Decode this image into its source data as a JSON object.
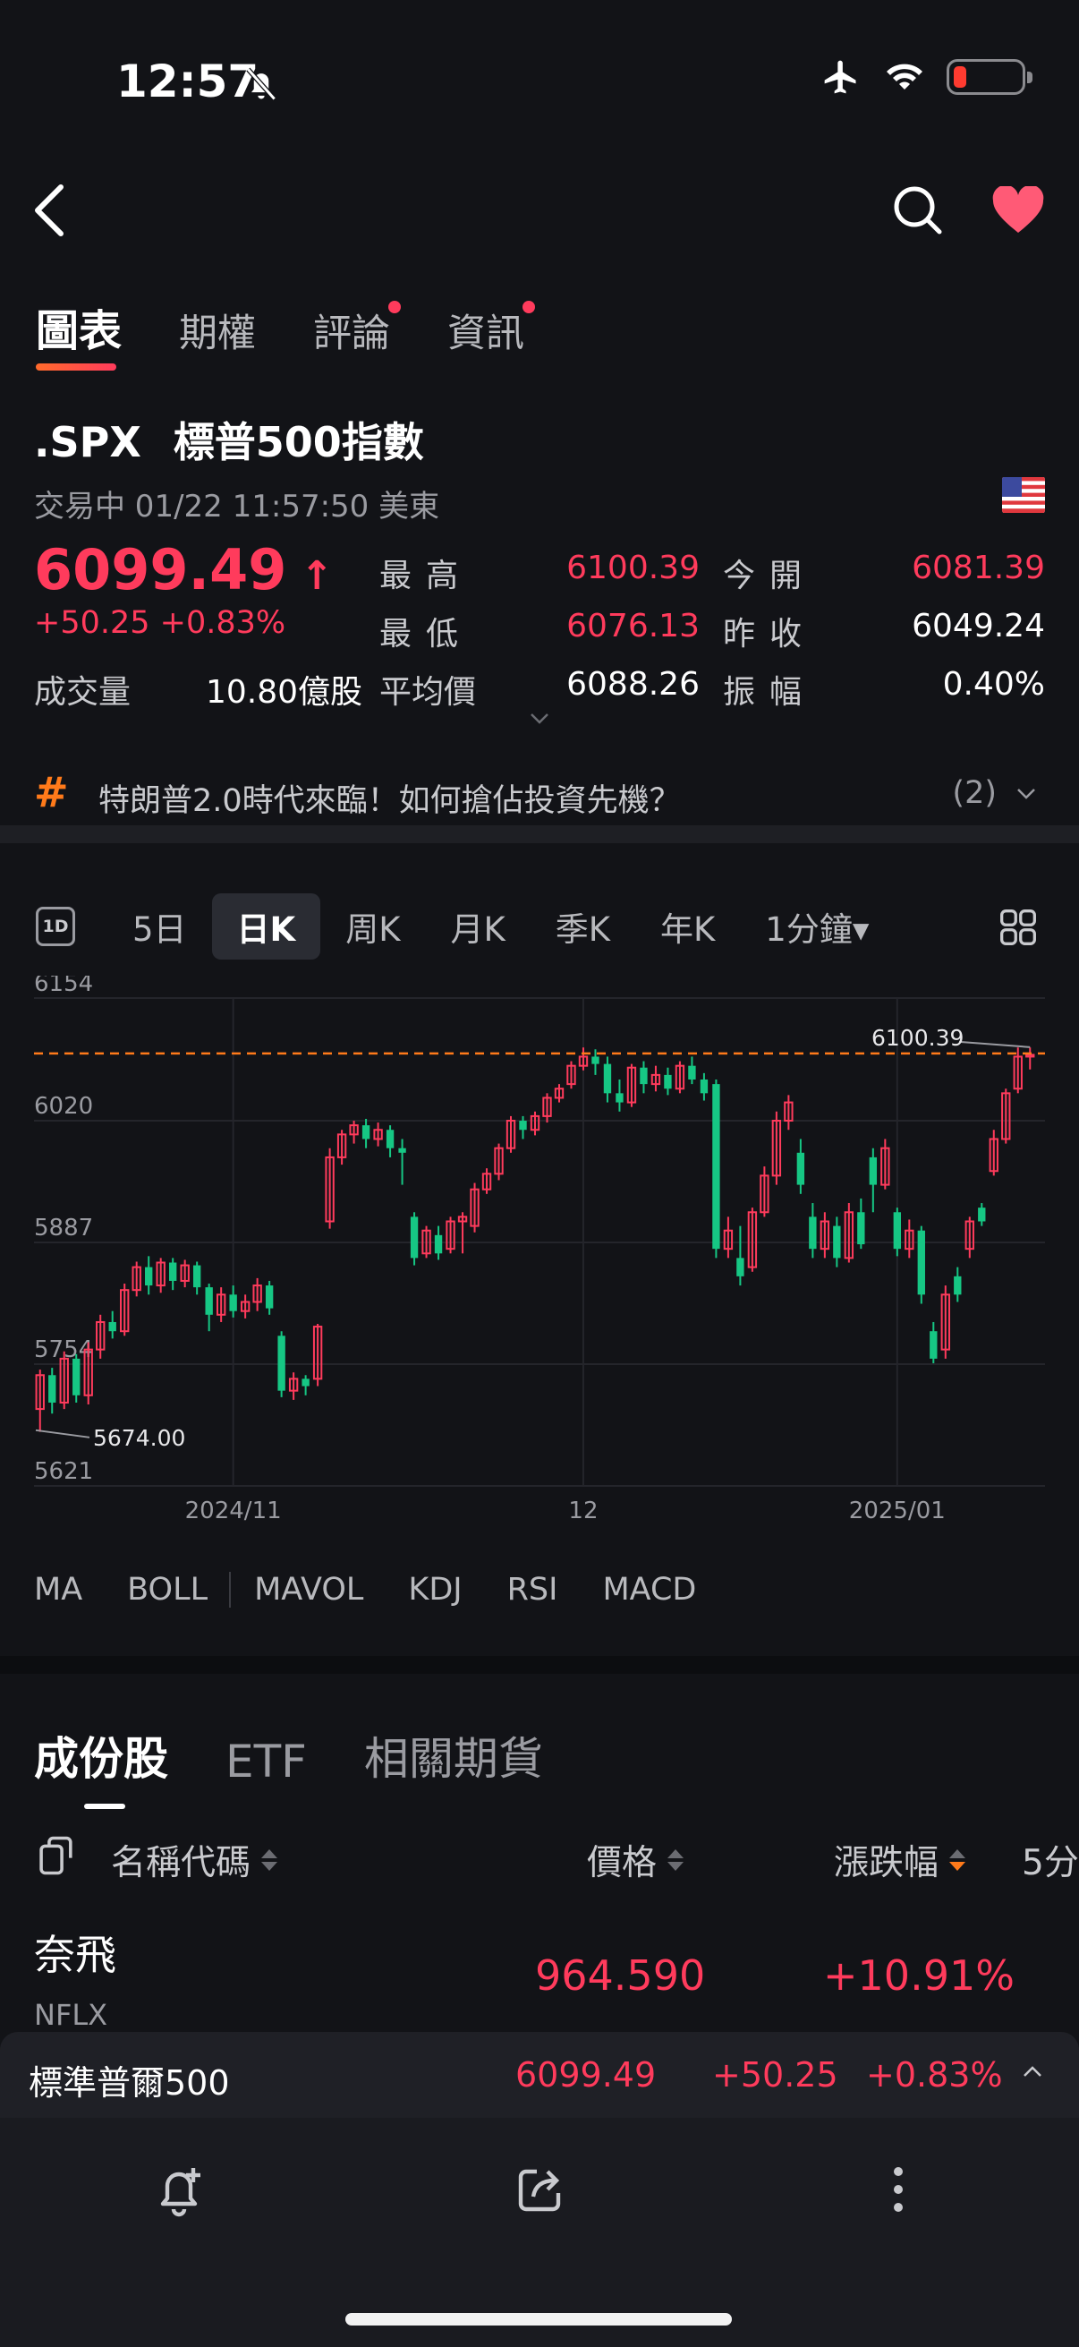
{
  "status_bar": {
    "time": "12:57"
  },
  "tabs": [
    {
      "label": "圖表",
      "active": true,
      "dot": false
    },
    {
      "label": "期權",
      "active": false,
      "dot": false
    },
    {
      "label": "評論",
      "active": false,
      "dot": true
    },
    {
      "label": "資訊",
      "active": false,
      "dot": true
    }
  ],
  "quote": {
    "symbol": ".SPX",
    "name": "標普500指數",
    "trading_status": "交易中 01/22 11:57:50 美東",
    "price": "6099.49",
    "change": "+50.25",
    "change_pct": "+0.83%",
    "volume_label": "成交量",
    "volume": "10.80億股",
    "stats": {
      "high_label": "最高",
      "high": "6100.39",
      "open_label": "今開",
      "open": "6081.39",
      "low_label": "最低",
      "low": "6076.13",
      "prev_close_label": "昨收",
      "prev_close": "6049.24",
      "avg_label": "平均價",
      "avg": "6088.26",
      "amp_label": "振幅",
      "amp": "0.40%"
    }
  },
  "topic": {
    "text": "特朗普2.0時代來臨！如何搶佔投資先機？",
    "count": "(2)"
  },
  "periods": {
    "icon_label": "1D",
    "items": [
      "5日",
      "日K",
      "周K",
      "月K",
      "季K",
      "年K",
      "1分鐘▾"
    ],
    "active": "日K"
  },
  "chart_data": {
    "type": "candlestick",
    "y_ticks": [
      "6154",
      "6020",
      "5887",
      "5754",
      "5621"
    ],
    "x_ticks": [
      "2024/11",
      "12",
      "2025/01"
    ],
    "high_marker": "6100.39",
    "low_marker": "5674.00",
    "ylim": [
      5621,
      6154
    ],
    "colors": {
      "up": "#ff3b5c",
      "down": "#16c784",
      "ref_line": "#ff7a1a"
    },
    "candles": [
      [
        5705,
        5742,
        5680,
        5748
      ],
      [
        5742,
        5712,
        5700,
        5750
      ],
      [
        5712,
        5760,
        5705,
        5768
      ],
      [
        5760,
        5720,
        5712,
        5765
      ],
      [
        5720,
        5770,
        5710,
        5778
      ],
      [
        5770,
        5800,
        5760,
        5808
      ],
      [
        5800,
        5790,
        5782,
        5812
      ],
      [
        5790,
        5835,
        5785,
        5842
      ],
      [
        5835,
        5860,
        5828,
        5866
      ],
      [
        5860,
        5840,
        5830,
        5872
      ],
      [
        5840,
        5865,
        5832,
        5870
      ],
      [
        5865,
        5845,
        5835,
        5870
      ],
      [
        5845,
        5862,
        5838,
        5868
      ],
      [
        5862,
        5838,
        5830,
        5866
      ],
      [
        5838,
        5808,
        5790,
        5842
      ],
      [
        5808,
        5830,
        5800,
        5838
      ],
      [
        5830,
        5812,
        5805,
        5840
      ],
      [
        5812,
        5822,
        5804,
        5830
      ],
      [
        5822,
        5840,
        5812,
        5848
      ],
      [
        5840,
        5815,
        5808,
        5845
      ],
      [
        5785,
        5725,
        5718,
        5790
      ],
      [
        5725,
        5738,
        5715,
        5745
      ],
      [
        5738,
        5730,
        5720,
        5742
      ],
      [
        5738,
        5795,
        5730,
        5798
      ],
      [
        5910,
        5980,
        5902,
        5990
      ],
      [
        5980,
        6005,
        5972,
        6010
      ],
      [
        6005,
        6015,
        5995,
        6020
      ],
      [
        6015,
        6000,
        5990,
        6022
      ],
      [
        6000,
        6010,
        5992,
        6018
      ],
      [
        6010,
        5990,
        5980,
        6015
      ],
      [
        5990,
        5985,
        5950,
        6000
      ],
      [
        5915,
        5870,
        5862,
        5920
      ],
      [
        5875,
        5900,
        5870,
        5905
      ],
      [
        5895,
        5875,
        5868,
        5905
      ],
      [
        5880,
        5910,
        5875,
        5915
      ],
      [
        5910,
        5915,
        5875,
        5920
      ],
      [
        5905,
        5945,
        5898,
        5952
      ],
      [
        5945,
        5962,
        5940,
        5968
      ],
      [
        5962,
        5990,
        5955,
        5995
      ],
      [
        5990,
        6020,
        5985,
        6025
      ],
      [
        6020,
        6010,
        6000,
        6025
      ],
      [
        6010,
        6025,
        6004,
        6030
      ],
      [
        6025,
        6045,
        6018,
        6050
      ],
      [
        6045,
        6055,
        6040,
        6060
      ],
      [
        6060,
        6080,
        6055,
        6085
      ],
      [
        6080,
        6090,
        6075,
        6100
      ],
      [
        6090,
        6082,
        6070,
        6098
      ],
      [
        6082,
        6050,
        6040,
        6090
      ],
      [
        6050,
        6040,
        6030,
        6065
      ],
      [
        6040,
        6078,
        6035,
        6082
      ],
      [
        6078,
        6060,
        6050,
        6085
      ],
      [
        6060,
        6070,
        6052,
        6080
      ],
      [
        6070,
        6055,
        6048,
        6078
      ],
      [
        6055,
        6080,
        6050,
        6085
      ],
      [
        6080,
        6065,
        6060,
        6090
      ],
      [
        6065,
        6050,
        6042,
        6072
      ],
      [
        6060,
        5880,
        5870,
        6065
      ],
      [
        5880,
        5900,
        5870,
        5915
      ],
      [
        5870,
        5850,
        5840,
        5905
      ],
      [
        5860,
        5920,
        5855,
        5925
      ],
      [
        5920,
        5960,
        5915,
        5970
      ],
      [
        5960,
        6020,
        5950,
        6030
      ],
      [
        6020,
        6040,
        6010,
        6048
      ],
      [
        5985,
        5950,
        5940,
        6000
      ],
      [
        5915,
        5880,
        5870,
        5930
      ],
      [
        5880,
        5910,
        5870,
        5920
      ],
      [
        5905,
        5870,
        5860,
        5915
      ],
      [
        5870,
        5920,
        5865,
        5930
      ],
      [
        5920,
        5885,
        5880,
        5935
      ],
      [
        5980,
        5950,
        5920,
        5990
      ],
      [
        5950,
        5990,
        5945,
        6000
      ],
      [
        5920,
        5880,
        5872,
        5925
      ],
      [
        5880,
        5900,
        5870,
        5912
      ],
      [
        5900,
        5830,
        5820,
        5905
      ],
      [
        5790,
        5760,
        5755,
        5800
      ],
      [
        5770,
        5830,
        5760,
        5840
      ],
      [
        5850,
        5830,
        5822,
        5860
      ],
      [
        5880,
        5910,
        5870,
        5915
      ],
      [
        5925,
        5910,
        5905,
        5930
      ],
      [
        5965,
        6000,
        5960,
        6010
      ],
      [
        6000,
        6050,
        5995,
        6055
      ],
      [
        6055,
        6090,
        6050,
        6100
      ],
      [
        6090,
        6092,
        6076,
        6100
      ]
    ]
  },
  "indicators": [
    "MA",
    "BOLL",
    "MAVOL",
    "KDJ",
    "RSI",
    "MACD"
  ],
  "constituents": {
    "tabs": [
      "成份股",
      "ETF",
      "相關期貨"
    ],
    "columns": {
      "name": "名稱代碼",
      "price": "價格",
      "change": "漲跌幅",
      "extra": "5分"
    },
    "rows": [
      {
        "name": "奈飛",
        "code": "NFLX",
        "price": "964.590",
        "change": "+10.91%"
      }
    ]
  },
  "bottom_quote": {
    "name": "標準普爾500",
    "price": "6099.49",
    "change": "+50.25",
    "change_pct": "+0.83%"
  }
}
